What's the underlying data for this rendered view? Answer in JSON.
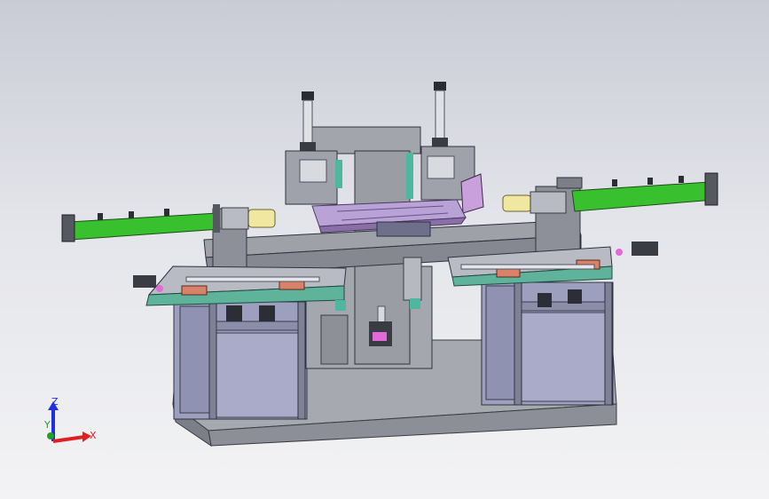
{
  "viewport": {
    "background_top": "#c9cbd6",
    "background_bottom": "#f3f3f5"
  },
  "model": {
    "name": "",
    "colors": {
      "frame": "#9ea0a8",
      "frame_dark": "#6f727c",
      "cabinet": "#a9abc8",
      "cylinder": "#39c02f",
      "rail": "#5fb39a",
      "block": "#d9826a",
      "magenta": "#e26ad8",
      "fixture": "#b9a3d6"
    }
  },
  "triad": {
    "x_label": "X",
    "y_label": "Y",
    "z_label": "Z",
    "x_color": "#e02020",
    "y_color": "#21a021",
    "z_color": "#2030e0",
    "icon": "axis-triad-icon"
  }
}
